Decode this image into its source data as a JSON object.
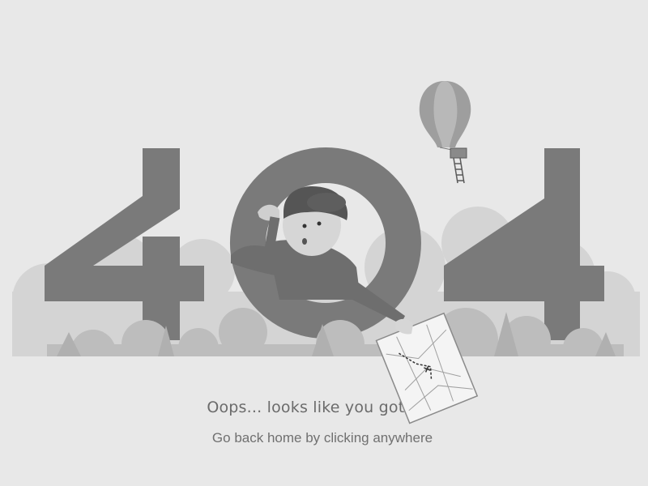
{
  "error_code": {
    "first_digit": "4",
    "middle_digit": "0",
    "last_digit": "4"
  },
  "message": {
    "headline": "Oops... looks like you got lost",
    "subline": "Go back home by clicking anywhere"
  },
  "colors": {
    "background": "#e8e8e8",
    "digits": "#7a7a7a",
    "bushes_back": "#d4d4d4",
    "bushes_front": "#bdbdbd",
    "text": "#6b6b6b"
  },
  "icons": {
    "balloon": "hot-air-balloon-icon",
    "person": "lost-explorer-illustration",
    "map": "map-illustration"
  }
}
